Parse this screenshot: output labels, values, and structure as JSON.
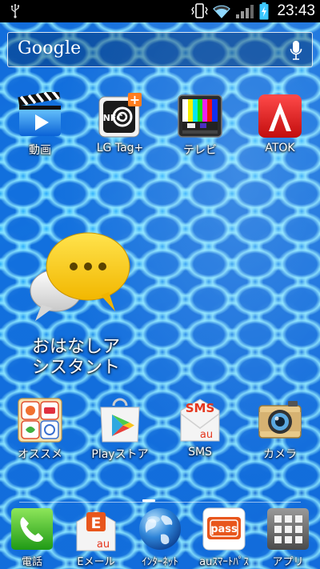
{
  "status_bar": {
    "time": "23:43"
  },
  "search_bar": {
    "logo": "Google"
  },
  "apps": [
    {
      "label": "動画",
      "icon": "video-clapper-icon"
    },
    {
      "label": "LG Tag+",
      "icon": "nfc-tag-icon"
    },
    {
      "label": "テレビ",
      "icon": "tv-color-bars-icon"
    },
    {
      "label": "ATOK",
      "icon": "atok-icon"
    },
    {
      "label": "オススメ",
      "icon": "recommend-folder-icon"
    },
    {
      "label": "Playストア",
      "icon": "play-store-icon"
    },
    {
      "label": "SMS",
      "icon": "sms-envelope-icon"
    },
    {
      "label": "カメラ",
      "icon": "camera-icon"
    }
  ],
  "widget": {
    "label": "おはなしア\nシスタント"
  },
  "dock": [
    {
      "label": "電話",
      "icon": "phone-icon"
    },
    {
      "label": "Eメール",
      "icon": "email-icon"
    },
    {
      "label": "ｲﾝﾀｰﾈｯﾄ",
      "icon": "globe-icon"
    },
    {
      "label": "auｽﾏｰﾄﾊﾟｽ",
      "icon": "au-smart-pass-icon"
    },
    {
      "label": "アプリ",
      "icon": "app-drawer-icon"
    }
  ],
  "icon_text": {
    "sms": "SMS",
    "au": "au",
    "pass": "pass",
    "e": "E",
    "nfc": "NFC",
    "atok_letter": "A",
    "plus": "+"
  }
}
